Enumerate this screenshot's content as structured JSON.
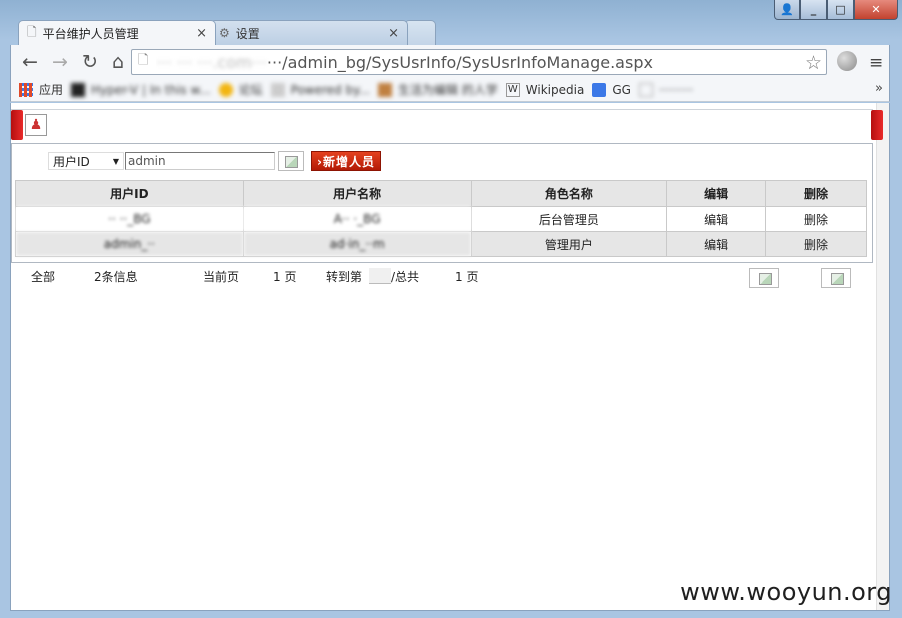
{
  "window": {
    "controls": [
      "_",
      "□",
      "✕"
    ]
  },
  "tabs": [
    {
      "label": "平台维护人员管理",
      "close": "×"
    },
    {
      "label": "设置",
      "close": "×"
    }
  ],
  "toolbar": {
    "back": "←",
    "forward": "→",
    "reload": "↻",
    "home": "⌂",
    "url_host": "··· ··· ···.com···",
    "url_path": "···/admin_bg/SysUsrInfo/SysUsrInfoManage.aspx",
    "star": "☆",
    "menu": "≡"
  },
  "bookmarks": {
    "items": [
      {
        "label": "应用",
        "color": "#e04a2a"
      },
      {
        "label": "Hyper-V | In this w...",
        "color": "#222222"
      },
      {
        "label": "论坛",
        "color": "#f2b511"
      },
      {
        "label": "Powered by...",
        "color": "#888888"
      },
      {
        "label": "生活为编辑 的人学",
        "color": "#c08040"
      },
      {
        "label": "Wikipedia",
        "color": "#444444"
      },
      {
        "label": "GG",
        "color": "#3b78e7"
      },
      {
        "label": "·········",
        "color": "#bbbbbb"
      }
    ],
    "more": "»"
  },
  "page": {
    "search": {
      "field_select": "用户ID",
      "keyword_value": "admin",
      "add_button": "›新增人员"
    },
    "table": {
      "headers": [
        "用户ID",
        "用户名称",
        "角色名称",
        "编辑",
        "删除"
      ],
      "rows": [
        {
          "user_id": "·· ··_BG",
          "user_name": "A·· ·_BG",
          "role": "后台管理员",
          "edit": "编辑",
          "delete": "删除"
        },
        {
          "user_id": "admin_··",
          "user_name": "ad·in_··m",
          "role": "管理用户",
          "edit": "编辑",
          "delete": "删除"
        }
      ]
    },
    "pager": {
      "all": "全部",
      "count": "2条信息",
      "current_label": "当前页",
      "current_page": "1 页",
      "goto_label": "转到第",
      "total_label": "/总共",
      "total_pages": "1 页"
    }
  },
  "watermark": "www.wooyun.org"
}
